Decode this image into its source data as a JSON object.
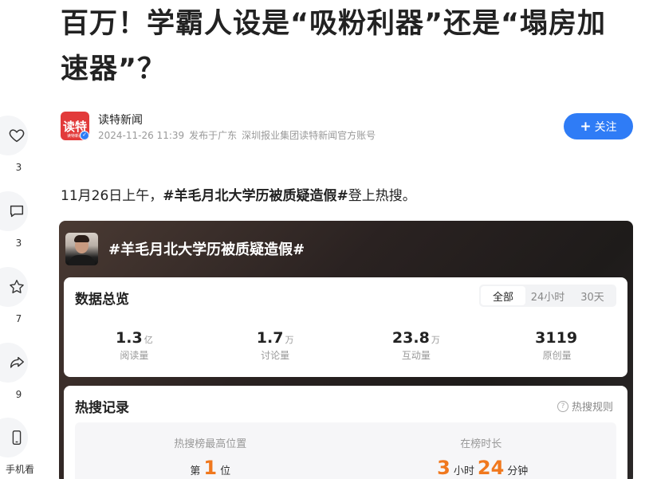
{
  "article": {
    "title": "百万！学霸人设是“吸粉利器”还是“塌房加速器”？",
    "author": {
      "avatar_text": "读特",
      "avatar_sub": "读特新闻",
      "name": "读特新闻",
      "datetime": "2024-11-26 11:39",
      "location": "发布于广东",
      "org": "深圳报业集团读特新闻官方账号"
    },
    "follow_label": "关注",
    "lead": {
      "before": "11月26日上午，",
      "hashtag": "#羊毛月北大学历被质疑造假#",
      "after": "登上热搜。"
    }
  },
  "sidebar": {
    "like_count": "3",
    "comment_count": "3",
    "favorite_count": "7",
    "share_count": "9",
    "mobile_label": "手机看"
  },
  "topic_card": {
    "title": "#羊毛月北大学历被质疑造假#",
    "overview": {
      "title": "数据总览",
      "tabs": [
        "全部",
        "24小时",
        "30天"
      ],
      "active_tab": "全部",
      "stats": [
        {
          "value": "1.3",
          "unit": "亿",
          "label": "阅读量"
        },
        {
          "value": "1.7",
          "unit": "万",
          "label": "讨论量"
        },
        {
          "value": "23.8",
          "unit": "万",
          "label": "互动量"
        },
        {
          "value": "3119",
          "unit": "",
          "label": "原创量"
        }
      ]
    },
    "hot_record": {
      "title": "热搜记录",
      "rule_label": "热搜规则",
      "highest_label": "热搜榜最高位置",
      "highest_prefix": "第",
      "highest_value": "1",
      "highest_suffix": "位",
      "duration_label": "在榜时长",
      "hours_value": "3",
      "hours_unit": "小时",
      "minutes_value": "24",
      "minutes_unit": "分钟"
    }
  },
  "colors": {
    "accent_blue": "#2f7cf6",
    "highlight_orange": "#f0781e",
    "avatar_red": "#e23a3a"
  }
}
